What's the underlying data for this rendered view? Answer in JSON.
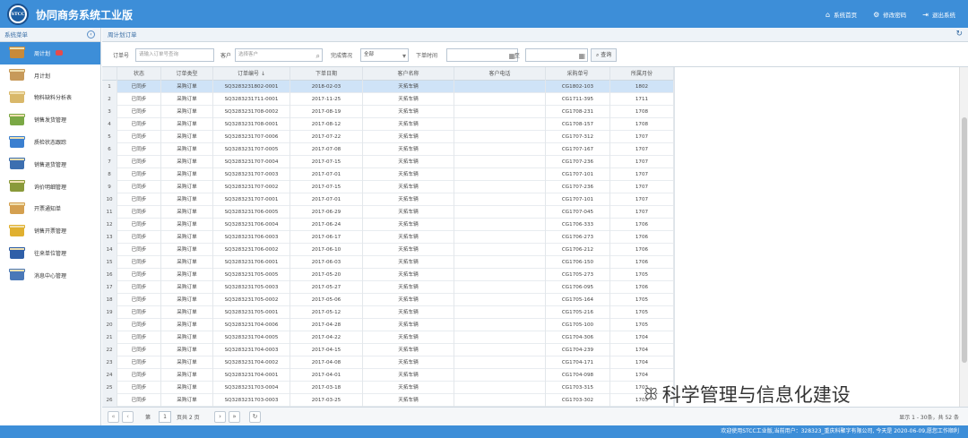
{
  "app": {
    "logo_text": "STCC",
    "title": "协同商务系统工业版"
  },
  "top_links": [
    {
      "icon": "home-icon",
      "glyph": "⌂",
      "label": "系统首页"
    },
    {
      "icon": "gear-icon",
      "glyph": "⚙",
      "label": "修改密码"
    },
    {
      "icon": "exit-icon",
      "glyph": "⇥",
      "label": "退出系统"
    }
  ],
  "sidebar": {
    "title": "系统菜单",
    "items": [
      {
        "label": "周计划",
        "color": "#c88a3a",
        "active": true,
        "badge": true
      },
      {
        "label": "月计划",
        "color": "#c79a5a"
      },
      {
        "label": "物料缺料分析表",
        "color": "#d9b86a"
      },
      {
        "label": "销售发货管理",
        "color": "#7aa845"
      },
      {
        "label": "质检状态跟踪",
        "color": "#3a7fd0"
      },
      {
        "label": "销售退货管理",
        "color": "#3d6fb0"
      },
      {
        "label": "询价明细管理",
        "color": "#8a9a3a"
      },
      {
        "label": "开票通知单",
        "color": "#d4a050"
      },
      {
        "label": "销售开票管理",
        "color": "#e0b030"
      },
      {
        "label": "往来单位管理",
        "color": "#2f5fa8"
      },
      {
        "label": "消息中心管理",
        "color": "#4a78b8"
      }
    ]
  },
  "tab": {
    "title": "周计划订单"
  },
  "filters": {
    "order_no_label": "订单号",
    "order_no_placeholder": "请输入订单号查询",
    "customer_label": "客户",
    "customer_placeholder": "选择客户",
    "status_label": "完成情况",
    "status_value": "全部",
    "date_label": "下单时间",
    "to_label": "至",
    "search_label": "查询"
  },
  "table": {
    "columns": [
      "状态",
      "订单类型",
      "订单编号 ↓",
      "下单日期",
      "客户名称",
      "客户电话",
      "采购单号",
      "所属月份"
    ],
    "rows": [
      [
        "已同步",
        "采购订单",
        "SQ3283231802-0001",
        "2018-02-03",
        "天拓车辆",
        "",
        "CG1802-103",
        "1802"
      ],
      [
        "已同步",
        "采购订单",
        "SQ3283231711-0001",
        "2017-11-25",
        "天拓车辆",
        "",
        "CG1711-395",
        "1711"
      ],
      [
        "已同步",
        "采购订单",
        "SQ3283231708-0002",
        "2017-08-19",
        "天拓车辆",
        "",
        "CG1708-231",
        "1708"
      ],
      [
        "已同步",
        "采购订单",
        "SQ3283231708-0001",
        "2017-08-12",
        "天拓车辆",
        "",
        "CG1708-157",
        "1708"
      ],
      [
        "已同步",
        "采购订单",
        "SQ3283231707-0006",
        "2017-07-22",
        "天拓车辆",
        "",
        "CG1707-312",
        "1707"
      ],
      [
        "已同步",
        "采购订单",
        "SQ3283231707-0005",
        "2017-07-08",
        "天拓车辆",
        "",
        "CG1707-167",
        "1707"
      ],
      [
        "已同步",
        "采购订单",
        "SQ3283231707-0004",
        "2017-07-15",
        "天拓车辆",
        "",
        "CG1707-236",
        "1707"
      ],
      [
        "已同步",
        "采购订单",
        "SQ3283231707-0003",
        "2017-07-01",
        "天拓车辆",
        "",
        "CG1707-101",
        "1707"
      ],
      [
        "已同步",
        "采购订单",
        "SQ3283231707-0002",
        "2017-07-15",
        "天拓车辆",
        "",
        "CG1707-236",
        "1707"
      ],
      [
        "已同步",
        "采购订单",
        "SQ3283231707-0001",
        "2017-07-01",
        "天拓车辆",
        "",
        "CG1707-101",
        "1707"
      ],
      [
        "已同步",
        "采购订单",
        "SQ3283231706-0005",
        "2017-06-29",
        "天拓车辆",
        "",
        "CG1707-045",
        "1707"
      ],
      [
        "已同步",
        "采购订单",
        "SQ3283231706-0004",
        "2017-06-24",
        "天拓车辆",
        "",
        "CG1706-333",
        "1706"
      ],
      [
        "已同步",
        "采购订单",
        "SQ3283231706-0003",
        "2017-06-17",
        "天拓车辆",
        "",
        "CG1706-273",
        "1706"
      ],
      [
        "已同步",
        "采购订单",
        "SQ3283231706-0002",
        "2017-06-10",
        "天拓车辆",
        "",
        "CG1706-212",
        "1706"
      ],
      [
        "已同步",
        "采购订单",
        "SQ3283231706-0001",
        "2017-06-03",
        "天拓车辆",
        "",
        "CG1706-150",
        "1706"
      ],
      [
        "已同步",
        "采购订单",
        "SQ3283231705-0005",
        "2017-05-20",
        "天拓车辆",
        "",
        "CG1705-273",
        "1705"
      ],
      [
        "已同步",
        "采购订单",
        "SQ3283231705-0003",
        "2017-05-27",
        "天拓车辆",
        "",
        "CG1706-095",
        "1706"
      ],
      [
        "已同步",
        "采购订单",
        "SQ3283231705-0002",
        "2017-05-06",
        "天拓车辆",
        "",
        "CG1705-164",
        "1705"
      ],
      [
        "已同步",
        "采购订单",
        "SQ3283231705-0001",
        "2017-05-12",
        "天拓车辆",
        "",
        "CG1705-216",
        "1705"
      ],
      [
        "已同步",
        "采购订单",
        "SQ3283231704-0006",
        "2017-04-28",
        "天拓车辆",
        "",
        "CG1705-100",
        "1705"
      ],
      [
        "已同步",
        "采购订单",
        "SQ3283231704-0005",
        "2017-04-22",
        "天拓车辆",
        "",
        "CG1704-306",
        "1704"
      ],
      [
        "已同步",
        "采购订单",
        "SQ3283231704-0003",
        "2017-04-15",
        "天拓车辆",
        "",
        "CG1704-239",
        "1704"
      ],
      [
        "已同步",
        "采购订单",
        "SQ3283231704-0002",
        "2017-04-08",
        "天拓车辆",
        "",
        "CG1704-171",
        "1704"
      ],
      [
        "已同步",
        "采购订单",
        "SQ3283231704-0001",
        "2017-04-01",
        "天拓车辆",
        "",
        "CG1704-098",
        "1704"
      ],
      [
        "已同步",
        "采购订单",
        "SQ3283231703-0004",
        "2017-03-18",
        "天拓车辆",
        "",
        "CG1703-315",
        "1703"
      ],
      [
        "已同步",
        "采购订单",
        "SQ3283231703-0003",
        "2017-03-25",
        "天拓车辆",
        "",
        "CG1703-302",
        "1703"
      ]
    ]
  },
  "pager": {
    "page_label": "第",
    "page_value": "1",
    "total_pages": "页共 2 页",
    "summary": "显示 1 - 30条，共 52 条"
  },
  "footer": {
    "text": "欢迎使用STCC工业版,当前用户：328323_重庆科聚字有限公司, 今天是 2020-06-09,愿您工作顺利"
  },
  "watermark": {
    "text": "科学管理与信息化建设"
  }
}
